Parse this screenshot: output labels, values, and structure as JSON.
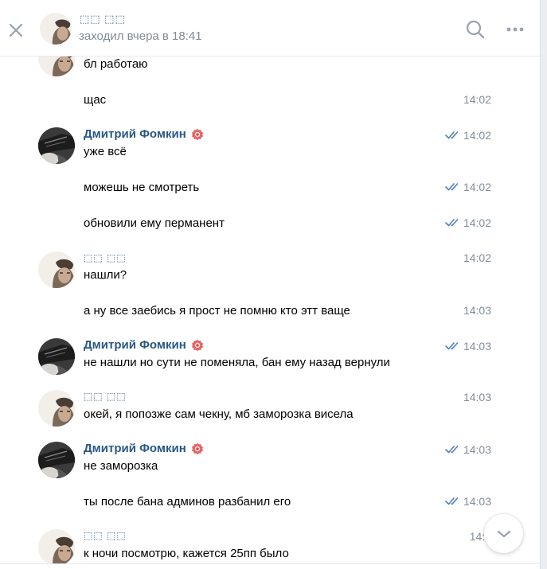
{
  "header": {
    "name": "⬚⬚ ⬚⬚",
    "status": "заходил вчера в 18:41"
  },
  "messages": [
    {
      "sender": "",
      "text": "бл работаю",
      "time": ""
    },
    {
      "text": "щас",
      "time": "14:02"
    },
    {
      "sender": "Дмитрий Фомкин",
      "text": "уже всё",
      "time": "14:02"
    },
    {
      "text": "можешь не смотреть",
      "time": "14:02"
    },
    {
      "text": "обновили ему перманент",
      "time": "14:02"
    },
    {
      "sender": "⬚⬚ ⬚⬚",
      "text": "нашли?",
      "time": "14:02"
    },
    {
      "text": "а ну все заебись я прост не помню кто этт ваще",
      "time": "14:03"
    },
    {
      "sender": "Дмитрий Фомкин",
      "text": "не нашли но сути не поменяла, бан ему назад вернули",
      "time": "14:03"
    },
    {
      "sender": "⬚⬚ ⬚⬚",
      "text": "окей, я попозже сам чекну, мб заморозка висела",
      "time": "14:03"
    },
    {
      "sender": "Дмитрий Фомкин",
      "text": "не заморозка",
      "time": "14:03"
    },
    {
      "text": "ты после бана админов разбанил его",
      "time": "14:03"
    },
    {
      "sender": "⬚⬚ ⬚⬚",
      "text": "к ночи посмотрю, кажется 25пп было",
      "time": "14:0"
    }
  ],
  "colors": {
    "accent": "#2a5885",
    "secondary": "#818c99",
    "tick": "#5181b8",
    "badge": "#e64646"
  },
  "icons": {
    "close": "close-icon",
    "search": "search-icon",
    "more": "more-icon",
    "read": "double-check-icon",
    "badge": "badge-icon",
    "scroll": "chevron-down-icon"
  }
}
